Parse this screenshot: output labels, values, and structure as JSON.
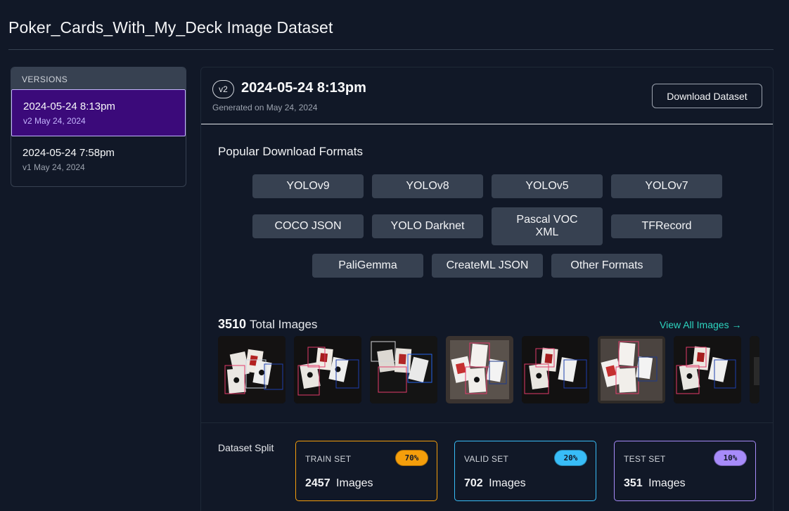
{
  "page": {
    "title": "Poker_Cards_With_My_Deck Image Dataset"
  },
  "versions": {
    "header": "VERSIONS",
    "items": [
      {
        "name": "2024-05-24 8:13pm",
        "sub": "v2 May 24, 2024",
        "active": true
      },
      {
        "name": "2024-05-24 7:58pm",
        "sub": "v1 May 24, 2024",
        "active": false
      }
    ]
  },
  "main": {
    "version_badge": "v2",
    "title": "2024-05-24 8:13pm",
    "generated": "Generated on May 24, 2024",
    "download_label": "Download Dataset",
    "formats_title": "Popular Download Formats",
    "formats": [
      "YOLOv9",
      "YOLOv8",
      "YOLOv5",
      "YOLOv7",
      "COCO JSON",
      "YOLO Darknet",
      "Pascal VOC XML",
      "TFRecord",
      "PaliGemma",
      "CreateML JSON",
      "Other Formats"
    ],
    "total_count": "3510",
    "total_label": "Total Images",
    "view_all": "View All Images →",
    "split_label": "Dataset Split",
    "splits": [
      {
        "name": "TRAIN SET",
        "pct": "70%",
        "count": "2457",
        "unit": "Images",
        "color": "#f59e0b"
      },
      {
        "name": "VALID SET",
        "pct": "20%",
        "count": "702",
        "unit": "Images",
        "color": "#38bdf8"
      },
      {
        "name": "TEST SET",
        "pct": "10%",
        "count": "351",
        "unit": "Images",
        "color": "#a78bfa"
      }
    ]
  },
  "colors": {
    "background": "#111827",
    "active_version": "#3b0a7a",
    "accent_link": "#2dd4bf",
    "button": "#374151"
  },
  "icons": {
    "view_all_arrow": "arrow-right-icon",
    "thumbnail_image": "image-thumbnail"
  }
}
